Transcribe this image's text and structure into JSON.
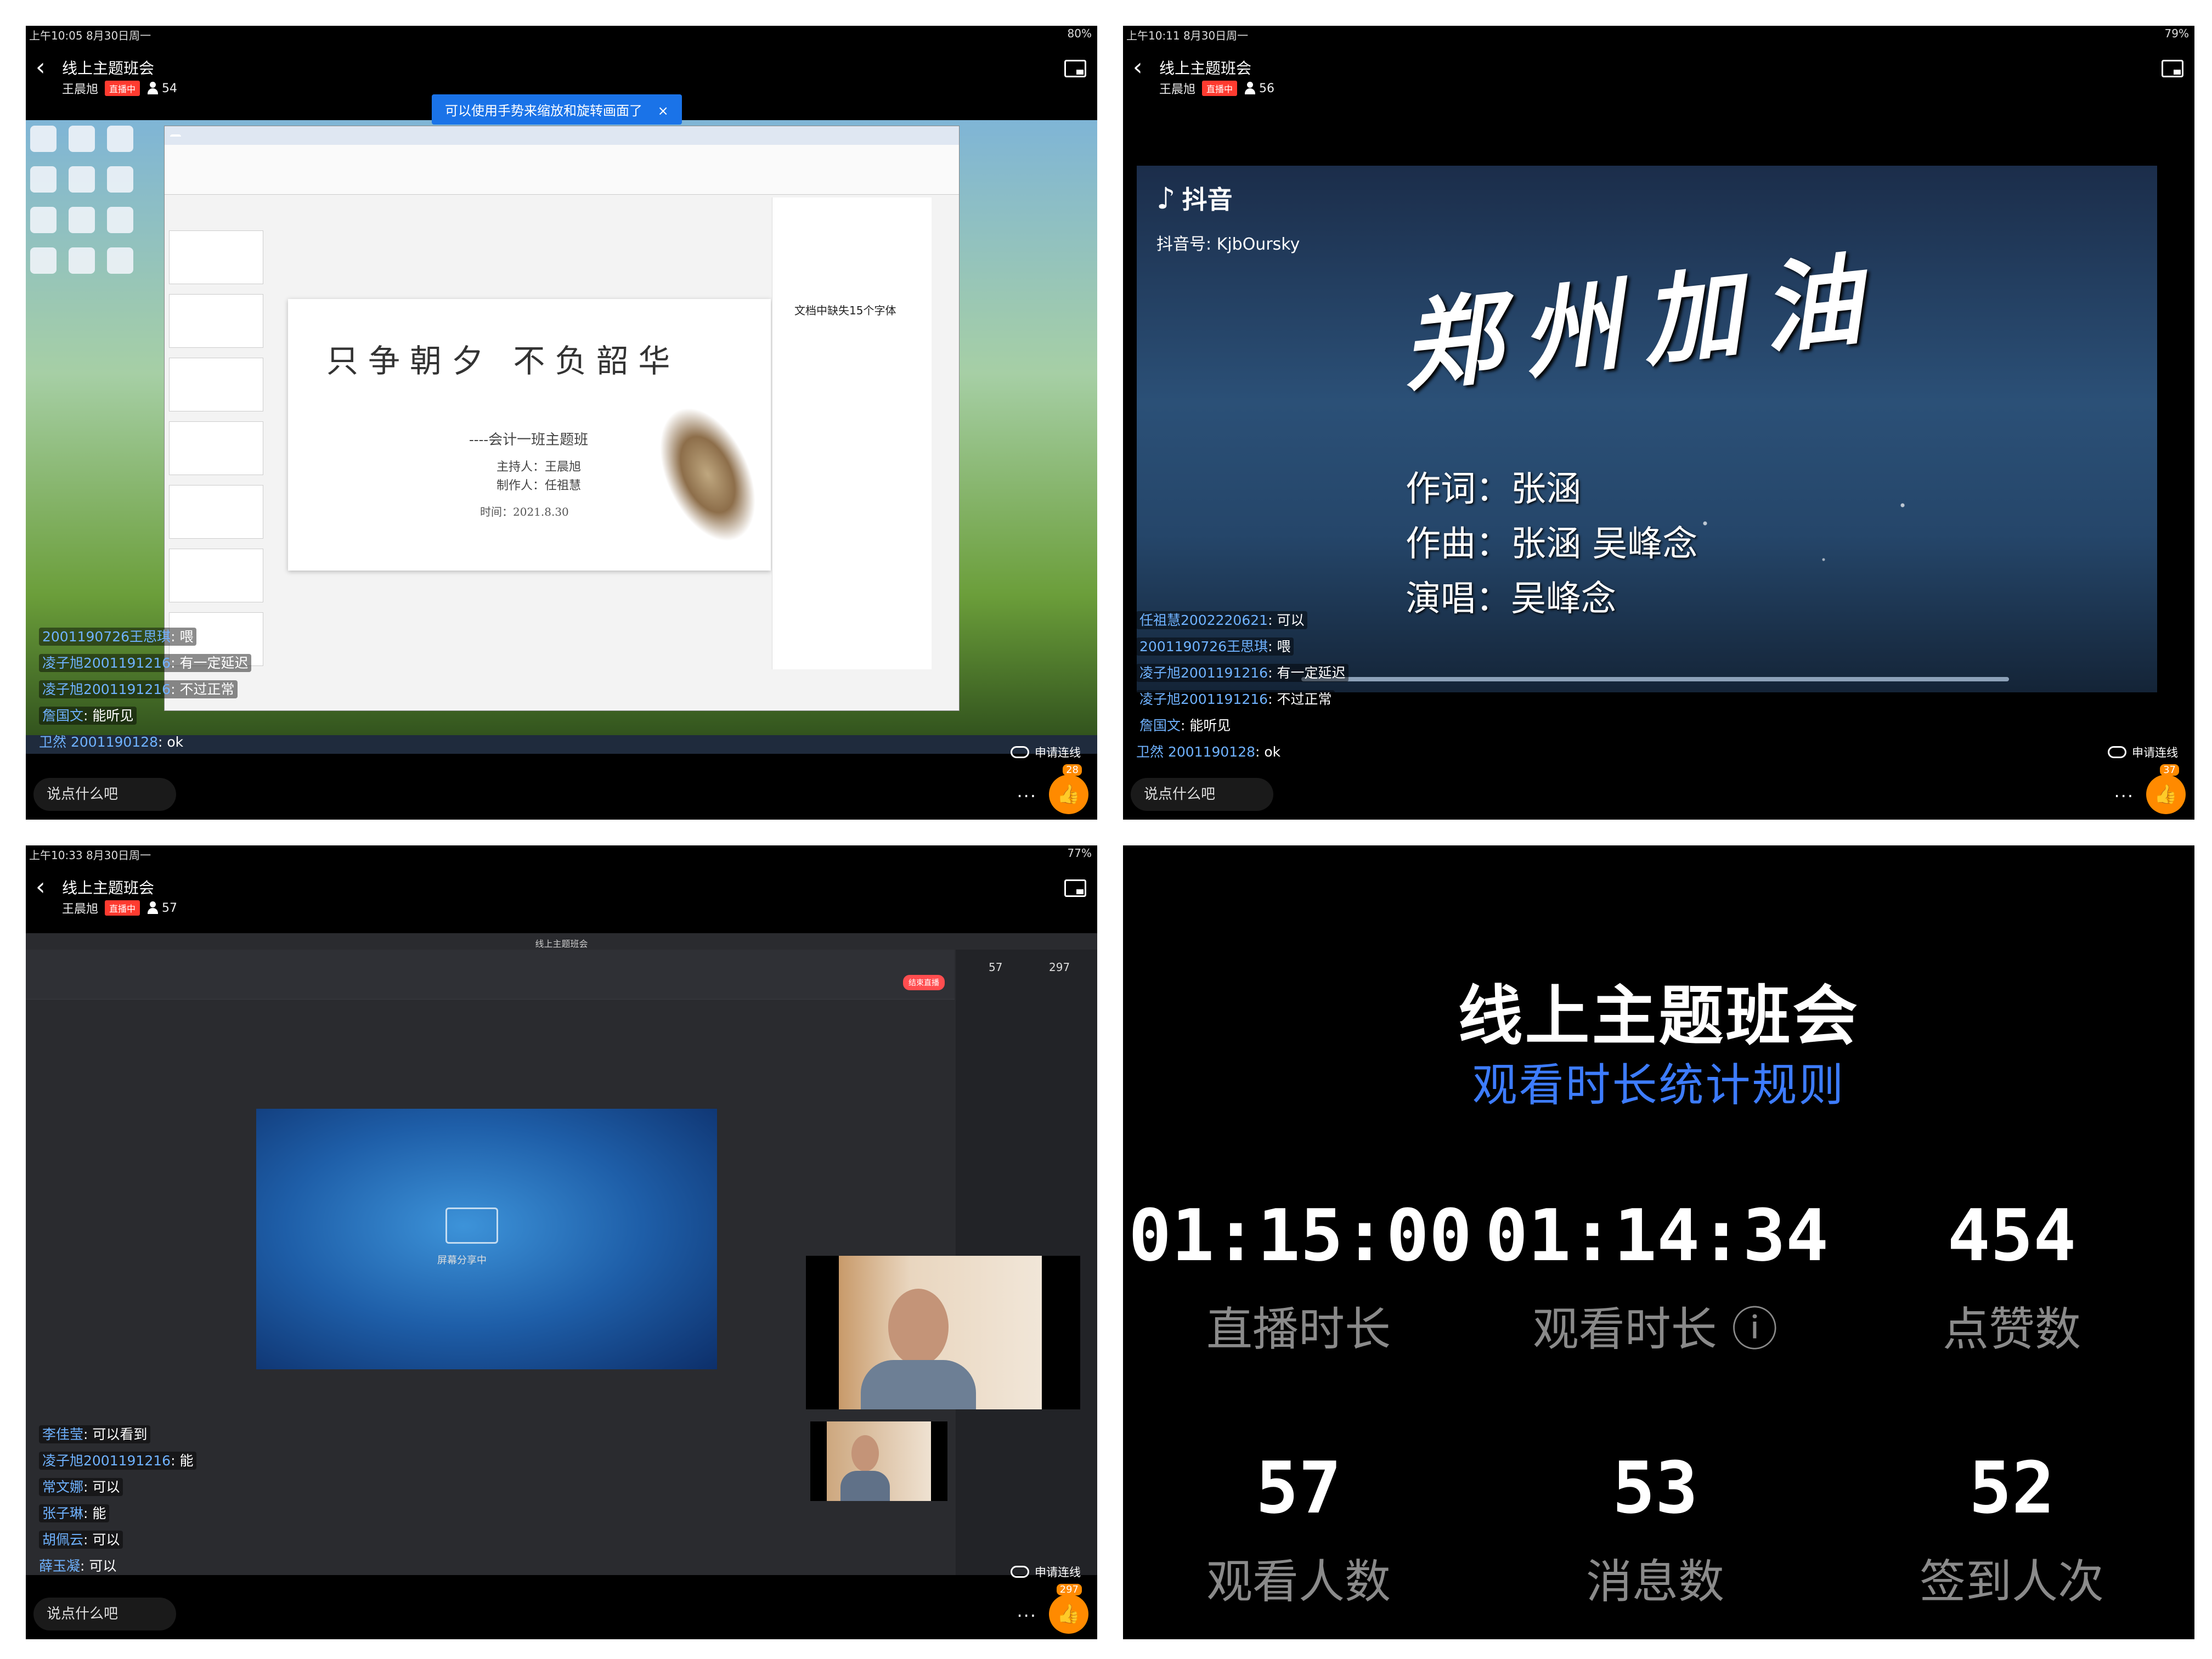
{
  "panels": {
    "p1": {
      "status_left": "上午10:05  8月30日周一",
      "status_right": "80%",
      "title": "线上主题班会",
      "host": "王晨旭",
      "live_badge": "直播中",
      "viewers": "54",
      "toast": "可以使用手势来缩放和旋转画面了",
      "toast_close": "×",
      "slide": {
        "title": "只争朝夕 不负韶华",
        "subtitle": "----会计一班主题班",
        "host": "主持人：王晨旭",
        "maker": "制作人：任祖慧",
        "date": "时间：2021.8.30"
      },
      "font_panel_title": "文档中缺失15个字体",
      "chat": [
        {
          "name": "2001190726王思琪",
          "text": "喂"
        },
        {
          "name": "凌子旭2001191216",
          "text": "有一定延迟"
        },
        {
          "name": "凌子旭2001191216",
          "text": "不过正常"
        },
        {
          "name": "詹国文",
          "text": "能听见"
        },
        {
          "name": "卫然 2001190128",
          "text": "ok"
        }
      ],
      "input_placeholder": "说点什么吧",
      "request_link": "申请连线",
      "more": "···",
      "likes": "28"
    },
    "p2": {
      "status_left": "上午10:11  8月30日周一",
      "status_right": "79%",
      "title": "线上主题班会",
      "host": "王晨旭",
      "live_badge": "直播中",
      "viewers": "56",
      "video": {
        "brand": "抖音",
        "account": "抖音号: KjbOursky",
        "song": "郑州加油",
        "lyricist": "作词：张涵",
        "composer": "作曲：张涵  吴峰念",
        "singer": "演唱：吴峰念"
      },
      "chat": [
        {
          "name": "任祖慧2002220621",
          "text": "可以"
        },
        {
          "name": "2001190726王思琪",
          "text": "喂"
        },
        {
          "name": "凌子旭2001191216",
          "text": "有一定延迟"
        },
        {
          "name": "凌子旭2001191216",
          "text": "不过正常"
        },
        {
          "name": "詹国文",
          "text": "能听见"
        },
        {
          "name": "卫然 2001190128",
          "text": "ok"
        }
      ],
      "input_placeholder": "说点什么吧",
      "request_link": "申请连线",
      "more": "···",
      "likes": "37"
    },
    "p3": {
      "status_left": "上午10:33  8月30日周一",
      "status_right": "77%",
      "title": "线上主题班会",
      "host": "王晨旭",
      "live_badge": "直播中",
      "viewers": "57",
      "meeting_title": "线上主题班会",
      "share_button": "结束直播",
      "stat_a": "57",
      "stat_b": "297",
      "share_label": "屏幕分享中",
      "chat": [
        {
          "name": "李佳莹",
          "text": "可以看到"
        },
        {
          "name": "凌子旭2001191216",
          "text": "能"
        },
        {
          "name": "常文娜",
          "text": "可以"
        },
        {
          "name": "张子琳",
          "text": "能"
        },
        {
          "name": "胡佩云",
          "text": "可以"
        },
        {
          "name": "薛玉凝",
          "text": "可以"
        }
      ],
      "input_placeholder": "说点什么吧",
      "request_link": "申请连线",
      "more": "···",
      "likes": "297"
    },
    "p4": {
      "title": "线上主题班会",
      "subtitle": "观看时长统计规则",
      "stats": [
        {
          "value": "01:15:00",
          "label": "直播时长"
        },
        {
          "value": "01:14:34",
          "label": "观看时长 ⓘ"
        },
        {
          "value": "454",
          "label": "点赞数"
        },
        {
          "value": "57",
          "label": "观看人数"
        },
        {
          "value": "53",
          "label": "消息数"
        },
        {
          "value": "52",
          "label": "签到人次"
        }
      ]
    }
  },
  "colors": {
    "chat_name": "#6fb2ff",
    "live_badge": "#ff3b30",
    "like": "#ff8a00",
    "stats_sub": "#3d7cff"
  }
}
